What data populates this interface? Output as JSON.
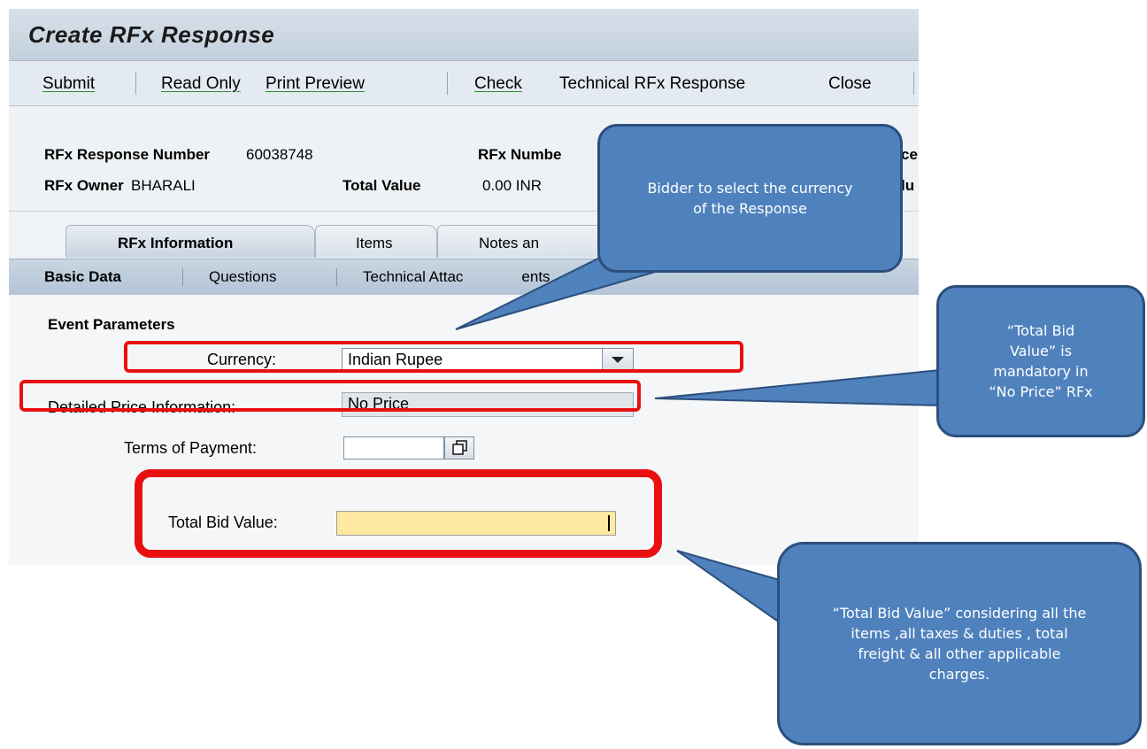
{
  "window": {
    "title": "Create RFx Response"
  },
  "toolbar": {
    "submit": "Submit",
    "read_only": "Read Only",
    "print_preview": "Print Preview",
    "check": "Check",
    "technical_response": "Technical RFx Response",
    "close": "Close"
  },
  "header": {
    "response_number_label": "RFx Response Number",
    "response_number_value": "60038748",
    "rfx_number_label": "RFx Numbe",
    "owner_label": "RFx Owner",
    "owner_value": "BHARALI",
    "total_value_label": "Total Value",
    "total_value_value": "0.00 INR",
    "cut_1": "ce",
    "cut_2": "lu"
  },
  "tabs": [
    "RFx Information",
    "Items",
    "Notes an"
  ],
  "subtabs": [
    "Basic Data",
    "Questions",
    "Technical Attac",
    "ents"
  ],
  "form": {
    "section_title": "Event Parameters",
    "currency_label": "Currency:",
    "currency_value": "Indian Rupee",
    "price_info_label": "Detailed Price Information:",
    "price_info_value": "No Price",
    "payment_terms_label": "Terms of Payment:",
    "payment_terms_value": "",
    "total_bid_label": "Total Bid Value:",
    "total_bid_value": ""
  },
  "callouts": {
    "currency_note": "Bidder to select the currency of the Response",
    "mandatory_note": "“Total Bid Value” is mandatory in “No Price” RFx",
    "total_note": "“Total Bid Value” considering all the items ,all taxes & duties , total freight & all other applicable charges."
  },
  "colors": {
    "highlight_red": "#e81010",
    "callout_fill": "#4f81bd",
    "callout_border": "#2c4f7c",
    "bid_field_fill": "#fdeaa0"
  },
  "icons": {
    "dropdown": "chevron-down-icon",
    "value_help": "value-help-icon"
  }
}
